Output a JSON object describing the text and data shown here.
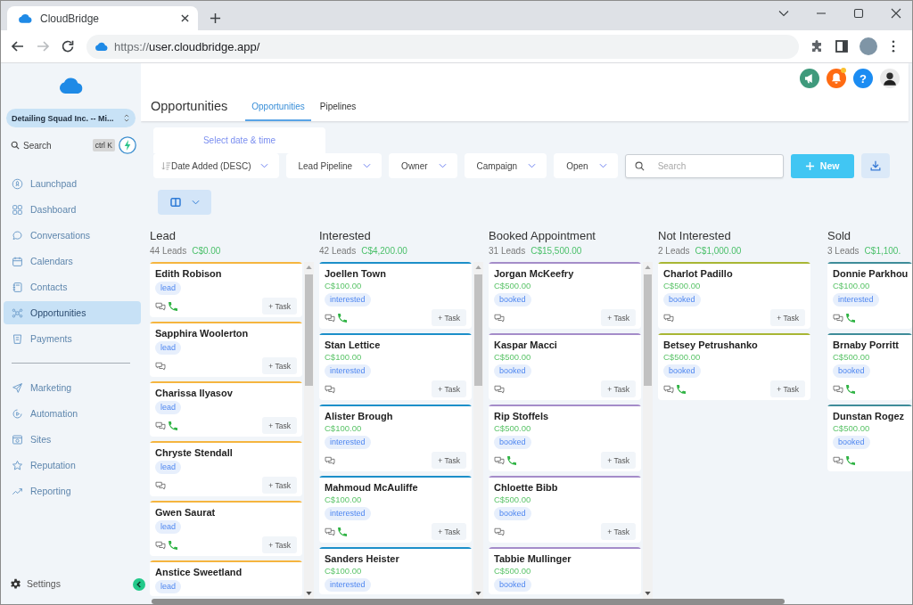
{
  "browser": {
    "tab_title": "CloudBridge",
    "address": {
      "scheme": "https://",
      "host": "user.cloudbridge.app/"
    },
    "back_disabled": false,
    "forward_disabled": true
  },
  "sidebar": {
    "account": "Detailing Squad Inc. -- Mi...",
    "search": {
      "placeholder": "Search",
      "shortcut": "ctrl K"
    },
    "groups": [
      {
        "items": [
          {
            "label": "Launchpad",
            "selected": false
          },
          {
            "label": "Dashboard",
            "selected": false
          },
          {
            "label": "Conversations",
            "selected": false
          },
          {
            "label": "Calendars",
            "selected": false
          },
          {
            "label": "Contacts",
            "selected": false
          },
          {
            "label": "Opportunities",
            "selected": true
          },
          {
            "label": "Payments",
            "selected": false
          }
        ]
      },
      {
        "items": [
          {
            "label": "Marketing",
            "selected": false
          },
          {
            "label": "Automation",
            "selected": false
          },
          {
            "label": "Sites",
            "selected": false
          },
          {
            "label": "Reputation",
            "selected": false
          },
          {
            "label": "Reporting",
            "selected": false
          }
        ]
      }
    ],
    "settings": "Settings"
  },
  "header": {
    "title": "Opportunities",
    "tabs": [
      {
        "label": "Opportunities",
        "selected": true
      },
      {
        "label": "Pipelines",
        "selected": false
      }
    ],
    "notifications_unread": true,
    "help": "?"
  },
  "filters": {
    "date_range": "Select date & time",
    "dropdowns": [
      {
        "label": "Date Added (DESC)",
        "kind": "sort"
      },
      {
        "label": "Lead Pipeline",
        "kind": "select"
      },
      {
        "label": "Owner",
        "kind": "select"
      },
      {
        "label": "Campaign",
        "kind": "select"
      },
      {
        "label": "Open",
        "kind": "select"
      }
    ],
    "search": {
      "placeholder": "Search"
    },
    "new_button": "New"
  },
  "board": {
    "columns": [
      {
        "title": "Lead",
        "count": "44 Leads",
        "total": "C$0.00",
        "color": "#f5b53f",
        "scrollbar": true,
        "cards": [
          {
            "name": "Edith Robison",
            "tag": "lead",
            "phone": true,
            "task": "+ Task"
          },
          {
            "name": "Sapphira Woolerton",
            "tag": "lead",
            "phone": false,
            "task": "+ Task"
          },
          {
            "name": "Charissa Ilyasov",
            "tag": "lead",
            "phone": true,
            "task": "+ Task"
          },
          {
            "name": "Chryste Stendall",
            "tag": "lead",
            "phone": false,
            "task": "+ Task"
          },
          {
            "name": "Gwen Saurat",
            "tag": "lead",
            "phone": true,
            "task": "+ Task"
          },
          {
            "name": "Anstice Sweetland",
            "tag": "lead"
          }
        ]
      },
      {
        "title": "Interested",
        "count": "42 Leads",
        "total": "C$4,200.00",
        "color": "#1c8fc9",
        "scrollbar": true,
        "cards": [
          {
            "name": "Joellen Town",
            "value": "C$100.00",
            "tag": "interested",
            "phone": true,
            "task": "+ Task"
          },
          {
            "name": "Stan Lettice",
            "value": "C$100.00",
            "tag": "interested",
            "phone": false,
            "task": "+ Task"
          },
          {
            "name": "Alister Brough",
            "value": "C$100.00",
            "tag": "interested",
            "phone": false,
            "task": "+ Task"
          },
          {
            "name": "Mahmoud McAuliffe",
            "value": "C$100.00",
            "tag": "interested",
            "phone": true,
            "task": "+ Task"
          },
          {
            "name": "Sanders Heister",
            "value": "C$100.00",
            "tag": "interested"
          }
        ]
      },
      {
        "title": "Booked Appointment",
        "count": "31 Leads",
        "total": "C$15,500.00",
        "color": "#a48cc9",
        "scrollbar": true,
        "cards": [
          {
            "name": "Jorgan McKeefry",
            "value": "C$500.00",
            "tag": "booked",
            "phone": false,
            "task": "+ Task"
          },
          {
            "name": "Kaspar Macci",
            "value": "C$500.00",
            "tag": "booked",
            "phone": false,
            "task": "+ Task"
          },
          {
            "name": "Rip Stoffels",
            "value": "C$500.00",
            "tag": "booked",
            "phone": true,
            "task": "+ Task"
          },
          {
            "name": "Chloette Bibb",
            "value": "C$500.00",
            "tag": "booked",
            "phone": false,
            "task": "+ Task"
          },
          {
            "name": "Tabbie Mullinger",
            "value": "C$500.00",
            "tag": "booked"
          }
        ]
      },
      {
        "title": "Not Interested",
        "count": "2 Leads",
        "total": "C$1,000.00",
        "color": "#a8b634",
        "scrollbar": false,
        "cards": [
          {
            "name": "Charlot Padillo",
            "value": "C$500.00",
            "tag": "booked",
            "phone": false,
            "task": "+ Task"
          },
          {
            "name": "Betsey Petrushanko",
            "value": "C$500.00",
            "tag": "booked",
            "phone": true,
            "task": "+ Task"
          }
        ]
      },
      {
        "title": "Sold",
        "count": "3 Leads",
        "total": "C$1,100.",
        "color": "#3e8c99",
        "scrollbar": false,
        "cards": [
          {
            "name": "Donnie Parkhou",
            "value": "C$100.00",
            "tag": "interested",
            "phone": true
          },
          {
            "name": "Brnaby Porritt",
            "value": "C$500.00",
            "tag": "booked",
            "phone": true
          },
          {
            "name": "Dunstan Rogez",
            "value": "C$500.00",
            "tag": "booked",
            "phone": true
          }
        ]
      }
    ]
  }
}
